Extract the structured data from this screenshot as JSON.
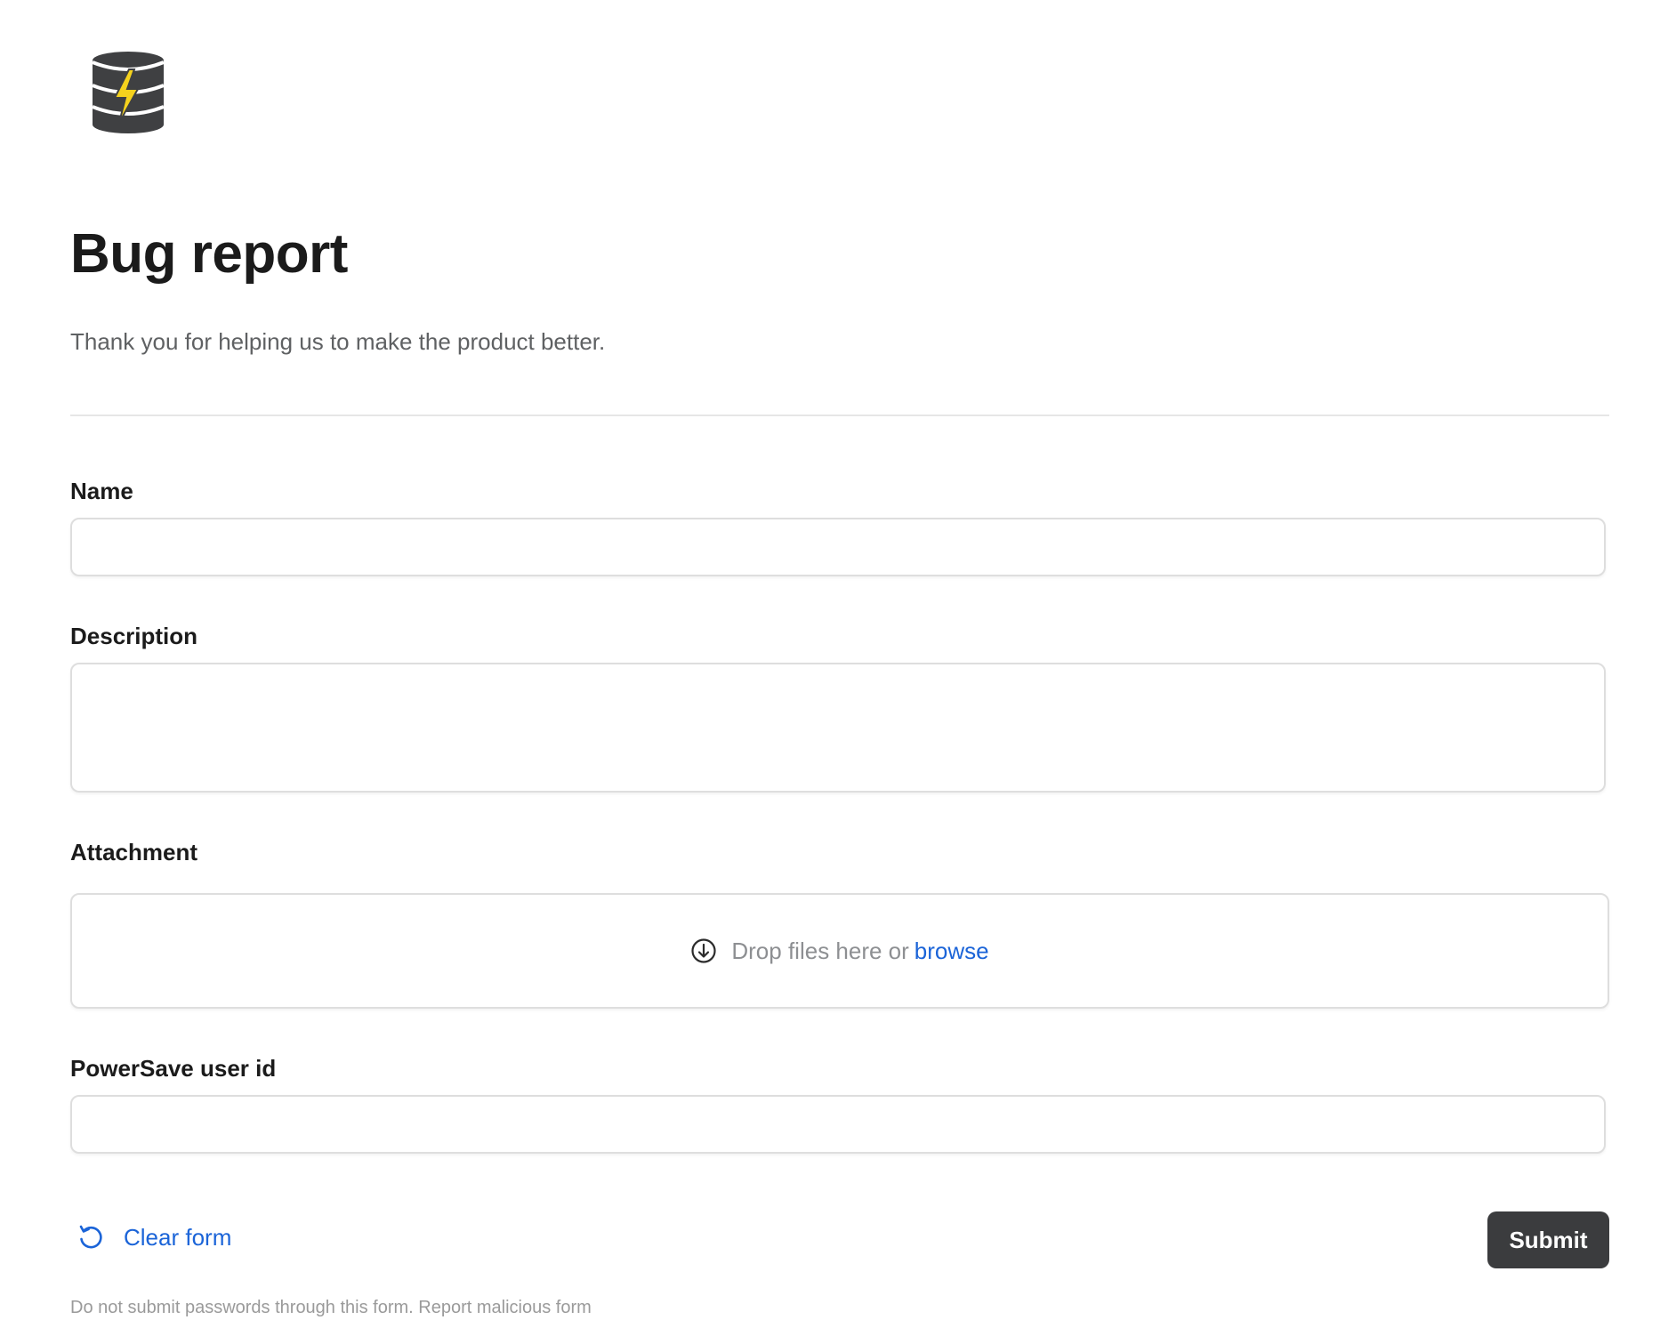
{
  "logo": {
    "icon": "database-lightning-icon",
    "colors": {
      "body": "#3f4042",
      "bolt": "#f5d21d"
    }
  },
  "form": {
    "title": "Bug report",
    "description": "Thank you for helping us to make the product better."
  },
  "fields": {
    "name": {
      "label": "Name",
      "value": "",
      "placeholder": ""
    },
    "description": {
      "label": "Description",
      "value": "",
      "placeholder": ""
    },
    "attachment": {
      "label": "Attachment",
      "drop_text": "Drop files here or",
      "browse_label": "browse",
      "icon": "download-circle-icon"
    },
    "user_id": {
      "label": "PowerSave user id",
      "value": "",
      "placeholder": ""
    }
  },
  "actions": {
    "clear_label": "Clear form",
    "clear_icon": "undo-icon",
    "submit_label": "Submit"
  },
  "footer": {
    "note": "Do not submit passwords through this form. Report malicious form"
  },
  "colors": {
    "link": "#1b64d8",
    "submit_bg": "#3b3c3e",
    "border": "#dedede"
  }
}
